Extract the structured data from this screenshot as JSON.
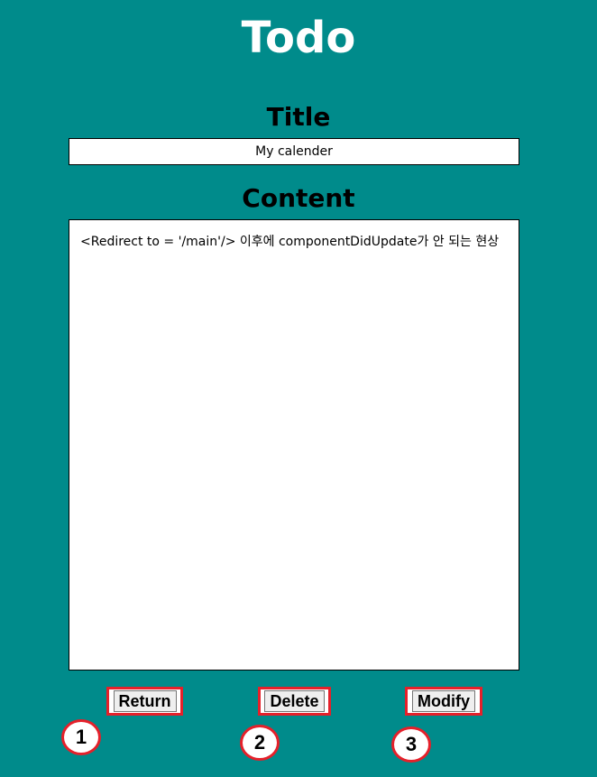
{
  "app": {
    "title": "Todo"
  },
  "form": {
    "title_label": "Title",
    "title_value": "My calender",
    "content_label": "Content",
    "content_value": "<Redirect to = '/main'/> 이후에 componentDidUpdate가 안 되는 현상"
  },
  "buttons": {
    "return_label": "Return",
    "delete_label": "Delete",
    "modify_label": "Modify"
  },
  "annotations": {
    "markers": [
      "1",
      "2",
      "3"
    ],
    "marker_color": "#e5202a"
  },
  "theme": {
    "background": "#008b8b",
    "title_color": "#ffffff"
  }
}
